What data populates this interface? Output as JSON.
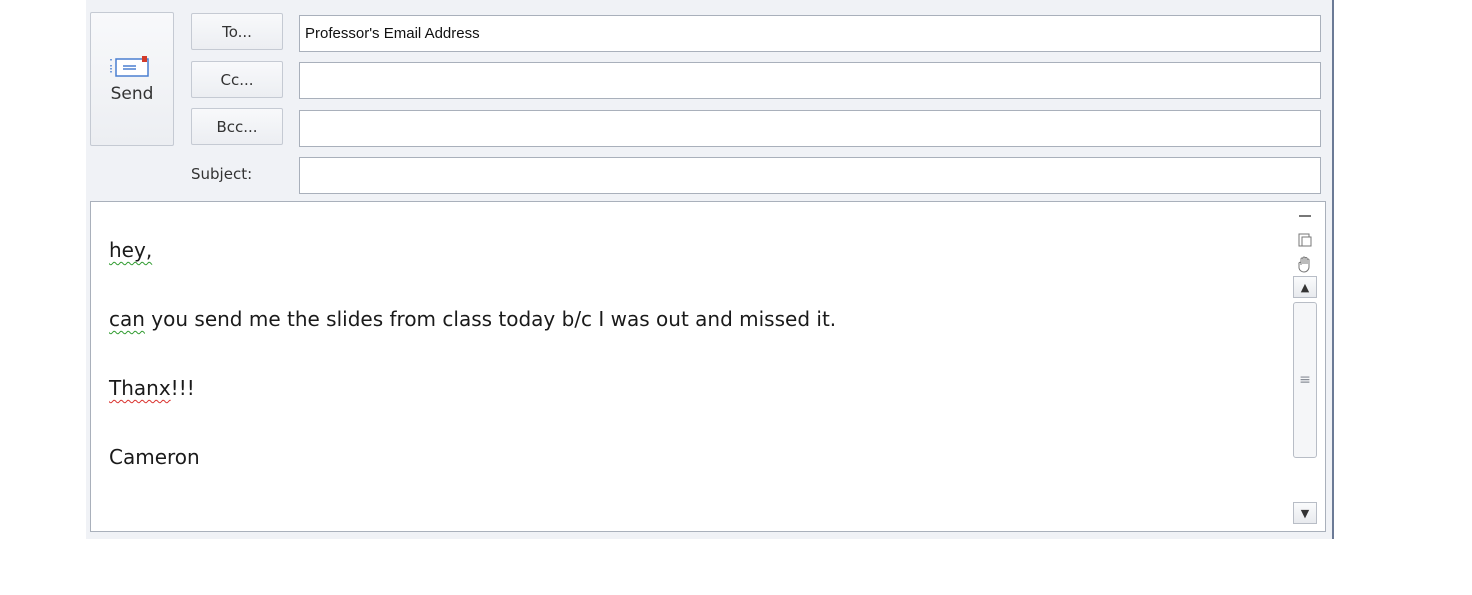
{
  "compose": {
    "send_label": "Send",
    "send_icon": "send-envelope-icon",
    "to_button": "To...",
    "cc_button": "Cc...",
    "bcc_button": "Bcc...",
    "subject_label": "Subject:",
    "to_value": "Professor's Email Address",
    "cc_value": "",
    "bcc_value": "",
    "subject_value": ""
  },
  "body": {
    "lines": [
      {
        "parts": [
          {
            "text": "hey,",
            "spell": "green"
          }
        ]
      },
      {
        "parts": [
          {
            "text": "can",
            "spell": "green"
          },
          {
            "text": " you send me the slides from class today b/c I was out and missed it.",
            "spell": null
          }
        ]
      },
      {
        "parts": [
          {
            "text": "Thanx",
            "spell": "red"
          },
          {
            "text": "!!!",
            "spell": null
          }
        ]
      },
      {
        "parts": [
          {
            "text": "Cameron",
            "spell": null
          }
        ]
      }
    ]
  },
  "scrollbar": {
    "tools": [
      "collapse-icon",
      "page-icon",
      "hand-pan-icon"
    ],
    "up_arrow": "▲",
    "grip": "≡",
    "down_arrow": "▼"
  },
  "colors": {
    "window_bg": "#f0f2f6",
    "spell_green": "#2e9a2e",
    "spell_red": "#d9302c"
  }
}
